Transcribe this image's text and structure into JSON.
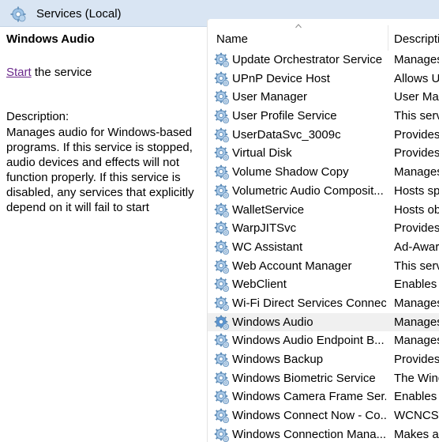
{
  "window": {
    "title": "Services (Local)",
    "icon": "services-icon"
  },
  "details": {
    "service_name": "Windows Audio",
    "start_link": "Start",
    "start_suffix": " the service",
    "description_label": "Description:",
    "description_text": "Manages audio for Windows-based programs.  If this service is stopped, audio devices and effects will not function properly.  If this service is disabled, any services that explicitly depend on it will fail to start"
  },
  "list": {
    "columns": {
      "name": "Name",
      "description": "Descripti"
    },
    "sort_indicator": "sort-ascending-arrow",
    "selected_color": "#f0f0f0",
    "rows": [
      {
        "name": "Update Orchestrator Service",
        "desc": "Manages"
      },
      {
        "name": "UPnP Device Host",
        "desc": "Allows U"
      },
      {
        "name": "User Manager",
        "desc": "User Man"
      },
      {
        "name": "User Profile Service",
        "desc": "This serv"
      },
      {
        "name": "UserDataSvc_3009c",
        "desc": "Provides"
      },
      {
        "name": "Virtual Disk",
        "desc": "Provides"
      },
      {
        "name": "Volume Shadow Copy",
        "desc": "Manages"
      },
      {
        "name": "Volumetric Audio Composit...",
        "desc": "Hosts spa"
      },
      {
        "name": "WalletService",
        "desc": "Hosts ob"
      },
      {
        "name": "WarpJITSvc",
        "desc": "Provides"
      },
      {
        "name": "WC Assistant",
        "desc": "Ad-Aware"
      },
      {
        "name": "Web Account Manager",
        "desc": "This serv"
      },
      {
        "name": "WebClient",
        "desc": "Enables V"
      },
      {
        "name": "Wi-Fi Direct Services Connec...",
        "desc": "Manages"
      },
      {
        "name": "Windows Audio",
        "desc": "Manages",
        "selected": true
      },
      {
        "name": "Windows Audio Endpoint B...",
        "desc": "Manages"
      },
      {
        "name": "Windows Backup",
        "desc": "Provides"
      },
      {
        "name": "Windows Biometric Service",
        "desc": "The Wind"
      },
      {
        "name": "Windows Camera Frame Ser...",
        "desc": "Enables n"
      },
      {
        "name": "Windows Connect Now - Co...",
        "desc": "WCNCSV"
      },
      {
        "name": "Windows Connection Mana...",
        "desc": "Makes au"
      }
    ]
  }
}
